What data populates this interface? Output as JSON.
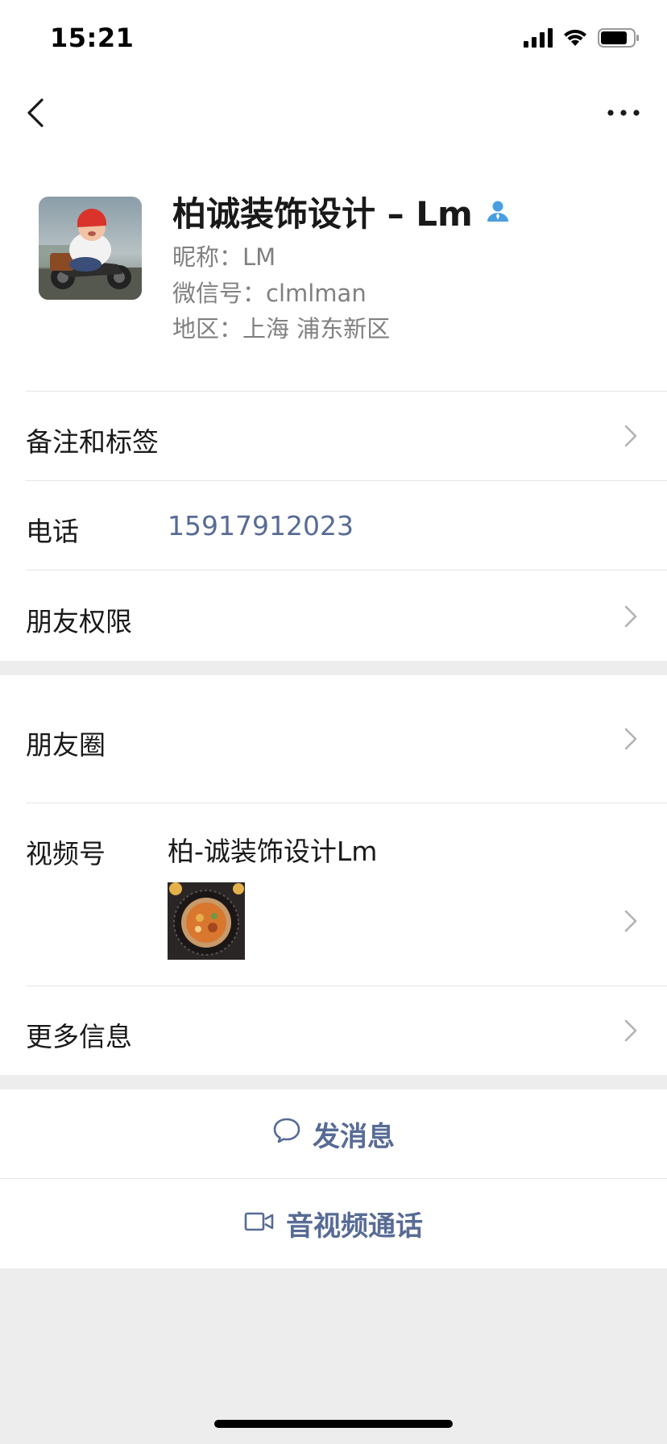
{
  "status_bar": {
    "time": "15:21",
    "signal_icon": "cellular-signal-icon",
    "wifi_icon": "wifi-icon",
    "battery_icon": "battery-icon"
  },
  "nav": {
    "back_icon": "chevron-left-icon",
    "more_icon": "more-dots-icon"
  },
  "profile": {
    "name": "柏诚装饰设计 – Lm",
    "badge_icon": "contact-person-icon",
    "nickname": "昵称：LM",
    "wechat_id": "微信号：clmlman",
    "region": "地区：上海 浦东新区"
  },
  "rows": {
    "notes_tags": "备注和标签",
    "phone_label": "电话",
    "phone_value": "15917912023",
    "friend_permissions": "朋友权限",
    "moments": "朋友圈",
    "channels_label": "视频号",
    "channels_value": "柏-诚装饰设计Lm",
    "more_info": "更多信息"
  },
  "actions": {
    "send_message": "发消息",
    "send_message_icon": "chat-bubble-icon",
    "av_call": "音视频通话",
    "av_call_icon": "video-camera-icon"
  },
  "colors": {
    "link_blue": "#576b95",
    "text_primary": "#191919",
    "text_secondary": "#808080",
    "background": "#ededed",
    "badge_blue": "#4a9ee0"
  }
}
